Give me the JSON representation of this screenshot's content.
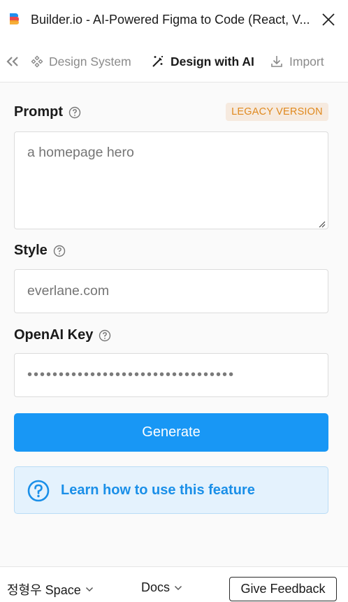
{
  "window": {
    "title": "Builder.io - AI-Powered Figma to Code (React, V...",
    "logo_icon": "builder-logo-icon",
    "close_icon": "close-icon"
  },
  "tabs": [
    {
      "label": "Design System",
      "icon": "design-system-icon",
      "active": false
    },
    {
      "label": "Design with AI",
      "icon": "magic-wand-icon",
      "active": true
    },
    {
      "label": "Import",
      "icon": "download-icon",
      "active": false
    }
  ],
  "form": {
    "prompt_label": "Prompt",
    "legacy_badge": "LEGACY VERSION",
    "prompt_placeholder": "a homepage hero",
    "style_label": "Style",
    "style_placeholder": "everlane.com",
    "key_label": "OpenAI Key",
    "key_value": "•••••••••••••••••••••••••••••••••",
    "generate_label": "Generate"
  },
  "help": {
    "learn_text": "Learn how to use this feature"
  },
  "footer": {
    "space_label": "정형우 Space",
    "docs_label": "Docs",
    "feedback_label": "Give Feedback"
  },
  "colors": {
    "accent": "#1897f5",
    "legacy_bg": "#f6eadf",
    "legacy_text": "#e0891e",
    "learn_bg": "#e4f2fd",
    "learn_text": "#1a8fe8"
  }
}
